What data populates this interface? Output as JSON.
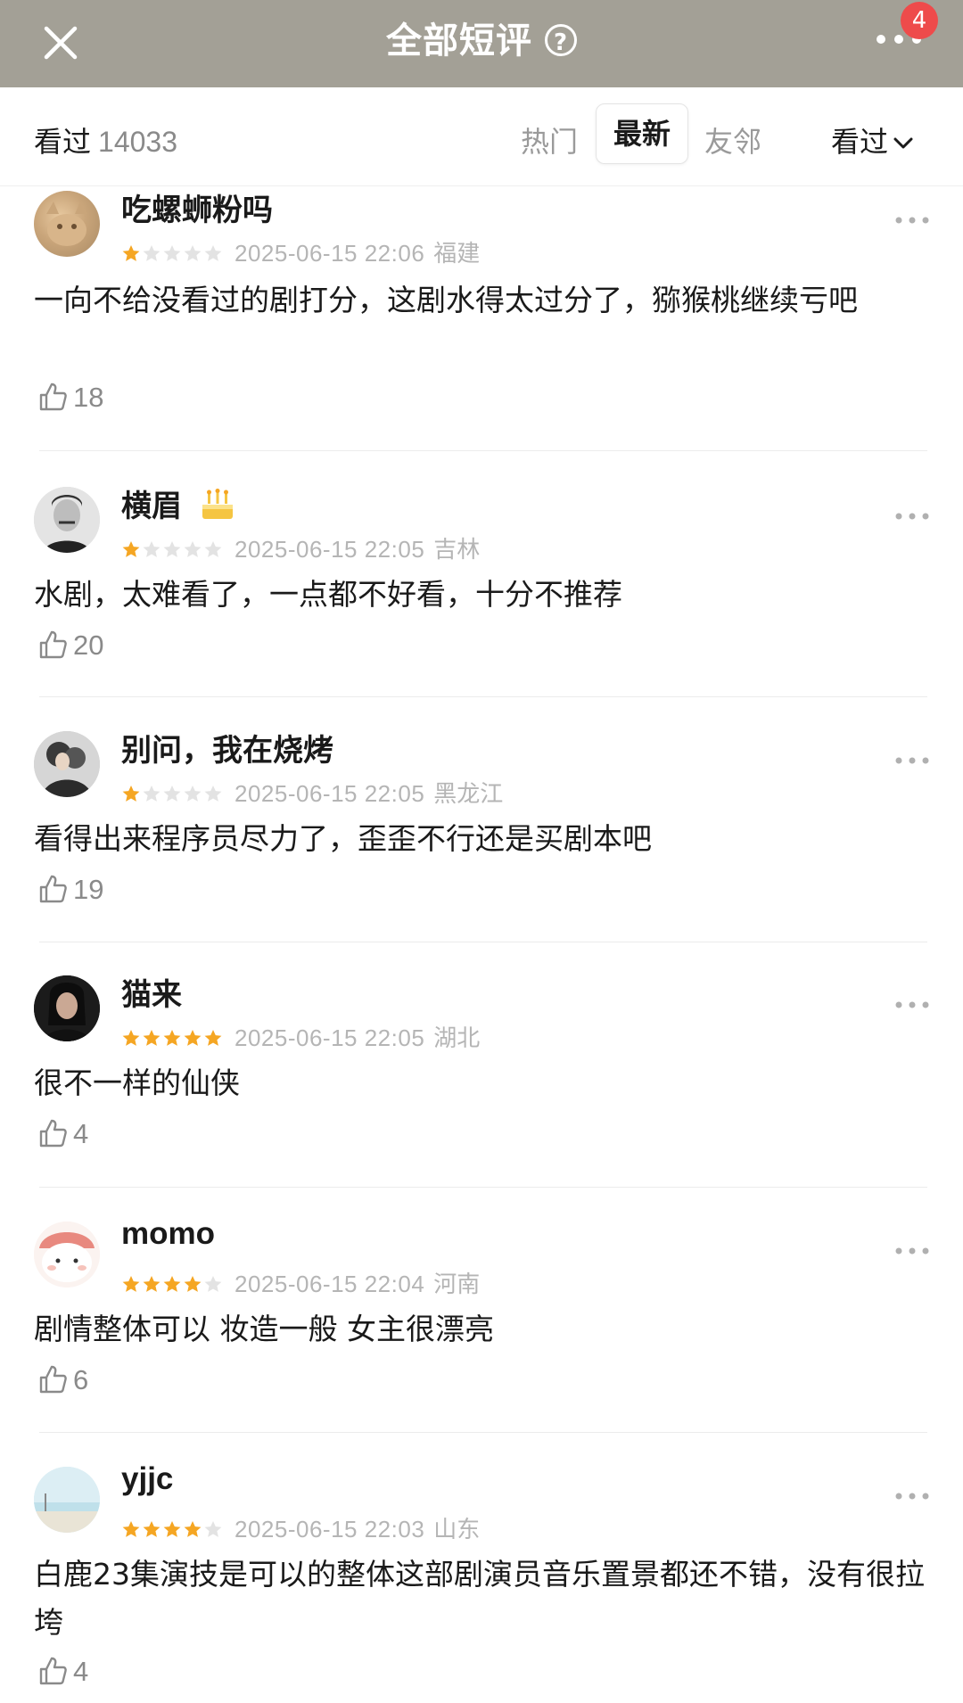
{
  "header": {
    "title": "全部短评",
    "help_icon": "question-circle-icon",
    "close_icon": "close-icon",
    "more_icon": "more-horizontal-icon",
    "badge_count": "4",
    "background": "#a3a096"
  },
  "tabbar": {
    "seen_label": "看过",
    "seen_count": "14033",
    "tabs": [
      "热门",
      "最新",
      "友邻"
    ],
    "active_tab": "最新",
    "filter_label": "看过"
  },
  "colors": {
    "star_on": "#f5a623",
    "star_off": "#e3e3e3",
    "badge": "#ee4b4b"
  },
  "reviews": [
    {
      "name": "吃螺蛳粉吗",
      "rating": 1,
      "date": "2025-06-15 22:06",
      "region": "福建",
      "text": "一向不给没看过的剧打分，这剧水得太过分了，猕猴桃继续亏吧",
      "likes": "18"
    },
    {
      "name": "横眉",
      "rating": 1,
      "date": "2025-06-15 22:05",
      "region": "吉林",
      "text": "水剧，太难看了，一点都不好看，十分不推荐",
      "likes": "20",
      "badge_icon": "birthday-cake-icon"
    },
    {
      "name": "别问，我在烧烤",
      "rating": 1,
      "date": "2025-06-15 22:05",
      "region": "黑龙江",
      "text": "看得出来程序员尽力了，歪歪不行还是买剧本吧",
      "likes": "19"
    },
    {
      "name": "猫来",
      "rating": 5,
      "date": "2025-06-15 22:05",
      "region": "湖北",
      "text": "很不一样的仙侠",
      "likes": "4"
    },
    {
      "name": "momo",
      "rating": 4,
      "date": "2025-06-15 22:04",
      "region": "河南",
      "text": "剧情整体可以 妆造一般 女主很漂亮",
      "likes": "6"
    },
    {
      "name": "yjjc",
      "rating": 4,
      "date": "2025-06-15 22:03",
      "region": "山东",
      "text": "白鹿23集演技是可以的整体这部剧演员音乐置景都还不错，没有很拉垮",
      "likes": "4"
    }
  ]
}
